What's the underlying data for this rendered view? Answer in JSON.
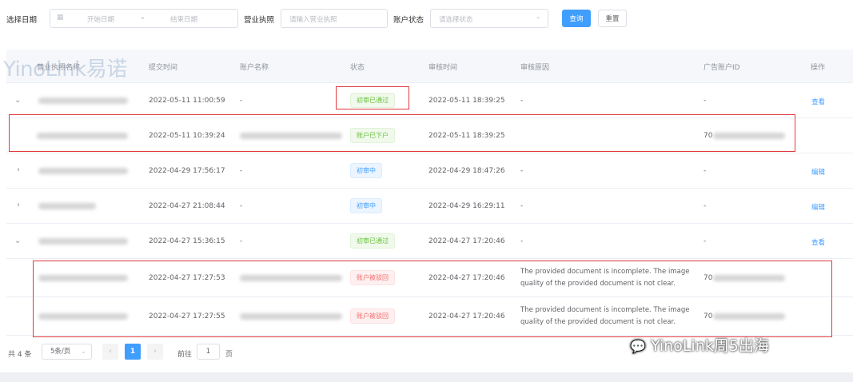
{
  "filters": {
    "date_label": "选择日期",
    "start_placeholder": "开始日期",
    "date_separator": "-",
    "end_placeholder": "结束日期",
    "license_label": "营业执照",
    "license_placeholder": "请输入营业执照",
    "status_label": "账户状态",
    "status_placeholder": "请选择状态",
    "search_label": "查询",
    "reset_label": "重置"
  },
  "table": {
    "headers": [
      "营业执照名称",
      "提交时间",
      "账户名称",
      "状态",
      "审核时间",
      "审核原因",
      "广告账户ID",
      "操作"
    ],
    "rows": [
      {
        "submit": "2022-05-11 11:00:59",
        "account": "-",
        "status": "初审已通过",
        "status_type": "success",
        "review": "2022-05-11 18:39:25",
        "reason": "-",
        "ad_id": "-",
        "action": "查看",
        "expand": "down"
      },
      {
        "submit": "2022-05-11 10:39:24",
        "account": "",
        "status": "账户已下户",
        "status_type": "success",
        "review": "2022-05-11 18:39:25",
        "reason": "",
        "ad_id": "70",
        "action": "",
        "expand": ""
      },
      {
        "submit": "2022-04-29 17:56:17",
        "account": "-",
        "status": "初审中",
        "status_type": "info",
        "review": "2022-04-29 18:47:26",
        "reason": "-",
        "ad_id": "-",
        "action": "编辑",
        "expand": "right"
      },
      {
        "submit": "2022-04-27 21:08:44",
        "account": "-",
        "status": "初审中",
        "status_type": "info",
        "review": "2022-04-29 16:29:11",
        "reason": "-",
        "ad_id": "-",
        "action": "编辑",
        "expand": "right"
      },
      {
        "submit": "2022-04-27 15:36:15",
        "account": "-",
        "status": "初审已通过",
        "status_type": "success",
        "review": "2022-04-27 17:20:46",
        "reason": "-",
        "ad_id": "-",
        "action": "查看",
        "expand": "down"
      },
      {
        "submit": "2022-04-27 17:27:53",
        "account": "",
        "status": "账户被驳回",
        "status_type": "danger",
        "review": "2022-04-27 17:20:46",
        "reason": "The provided document is incomplete. The image quality of the provided document is not clear.",
        "ad_id": "70",
        "action": "",
        "expand": ""
      },
      {
        "submit": "2022-04-27 17:27:55",
        "account": "",
        "status": "账户被驳回",
        "status_type": "danger",
        "review": "2022-04-27 17:20:46",
        "reason": "The provided document is incomplete. The image quality of the provided document is not clear.",
        "ad_id": "70",
        "action": "",
        "expand": ""
      }
    ]
  },
  "pagination": {
    "total": "共 4 条",
    "page_size": "5条/页",
    "current": "1",
    "goto_label": "前往",
    "goto_value": "1",
    "page_unit": "页"
  },
  "watermark": {
    "brand": "YinoLink易诺",
    "footer": "YinoLink周5出海"
  },
  "colors": {
    "primary": "#409eff",
    "success": "#67c23a",
    "danger": "#f56c6c",
    "annotation": "#e0393e"
  }
}
